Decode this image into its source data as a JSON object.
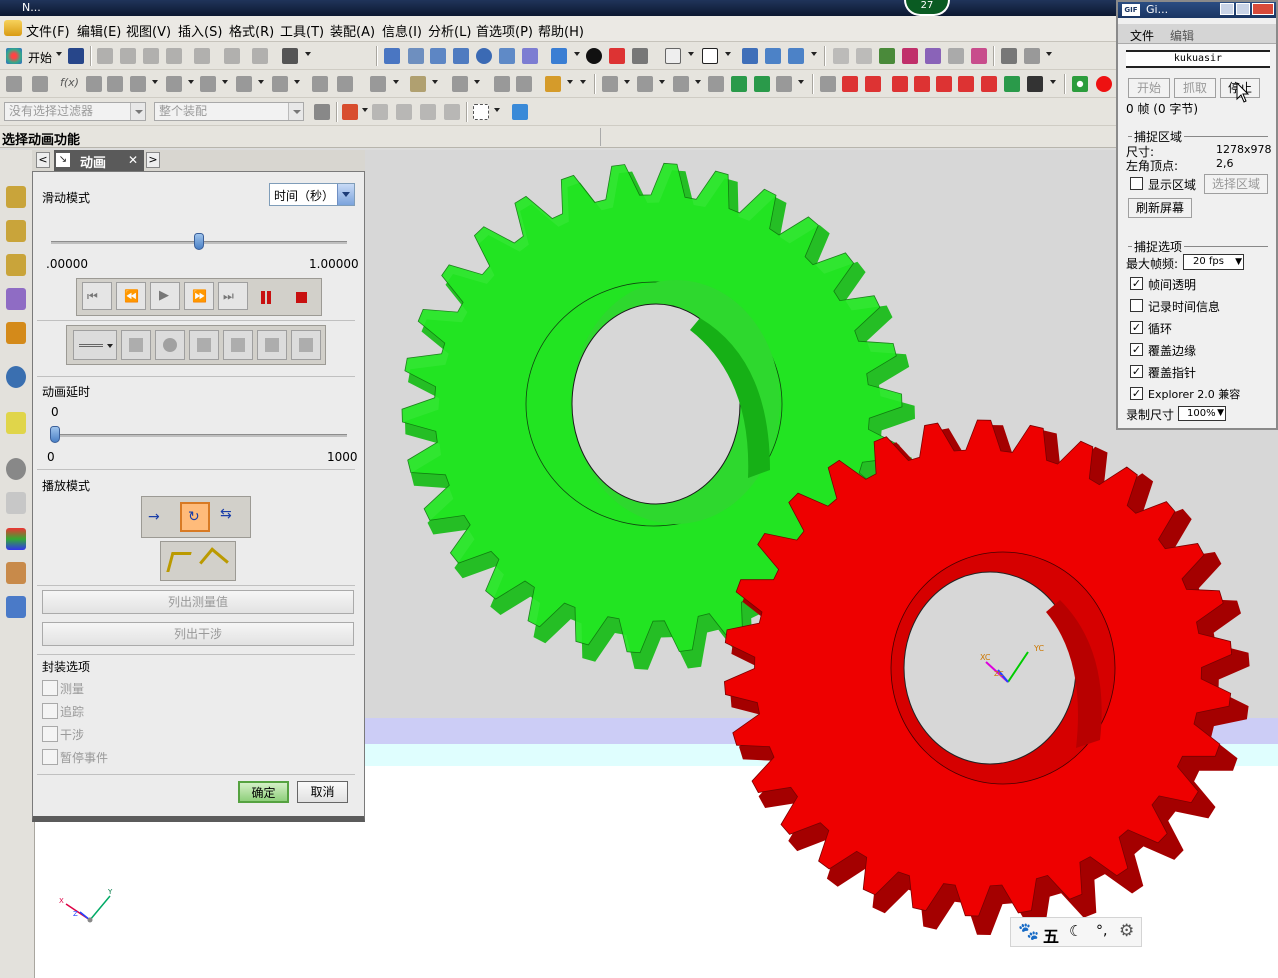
{
  "titlebar": {
    "app_title": "N..."
  },
  "menubar": {
    "items": [
      "文件(F)",
      "编辑(E)",
      "视图(V)",
      "插入(S)",
      "格式(R)",
      "工具(T)",
      "装配(A)",
      "信息(I)",
      "分析(L)",
      "首选项(P)",
      "帮助(H)"
    ],
    "start_label": "开始",
    "status_badge": "27"
  },
  "filter": {
    "selection_filter_placeholder": "没有选择过滤器",
    "scope_placeholder": "整个装配"
  },
  "cue": {
    "text": "选择动画功能"
  },
  "dialog": {
    "tab_title": "动画",
    "slider_mode_label": "滑动模式",
    "slider_mode_value": "时间（秒）",
    "time_min": ".00000",
    "time_max": "1.00000",
    "time_position": 0.5,
    "delay_label": "动画延时",
    "delay_value": "0",
    "delay_min": "0",
    "delay_max": "1000",
    "play_mode_label": "播放模式",
    "list_measure": "列出测量值",
    "list_interference": "列出干涉",
    "encap_label": "封装选项",
    "encap_options": [
      "测量",
      "追踪",
      "干涉",
      "暂停事件"
    ],
    "ok": "确定",
    "cancel": "取消"
  },
  "capture": {
    "title": "Gi...",
    "menu_file": "文件",
    "menu_edit": "编辑",
    "banner": "kukuasir",
    "btn_start": "开始",
    "btn_grab": "抓取",
    "btn_stop": "停止",
    "frames": "0 帧 (0 字节)",
    "region_group": "捕捉区域",
    "size_label": "尺寸:",
    "size_value": "1278x978",
    "corner_label": "左角顶点:",
    "corner_value": "2,6",
    "show_region": "显示区域",
    "select_region": "选择区域",
    "refresh": "刷新屏幕",
    "options_group": "捕捉选项",
    "maxfps_label": "最大帧频:",
    "maxfps_value": "20 fps",
    "options": [
      {
        "label": "帧间透明",
        "checked": true
      },
      {
        "label": "记录时间信息",
        "checked": false
      },
      {
        "label": "循环",
        "checked": true
      },
      {
        "label": "覆盖边缘",
        "checked": true
      },
      {
        "label": "覆盖指针",
        "checked": true
      },
      {
        "label": "Explorer 2.0 兼容",
        "checked": true
      }
    ],
    "rec_size_label": "录制尺寸",
    "rec_size_value": "100%"
  },
  "viewport": {
    "csys_main": "XC",
    "csys_main2": "YC",
    "csys_main3": "ZC",
    "csys_corner_x": "X",
    "csys_corner_y": "Y",
    "csys_corner_z": "Z"
  },
  "ime": {
    "char": "五"
  },
  "colors": {
    "green_gear": "#22e822",
    "red_gear": "#ee0000",
    "accent": "#3a6fb0"
  }
}
